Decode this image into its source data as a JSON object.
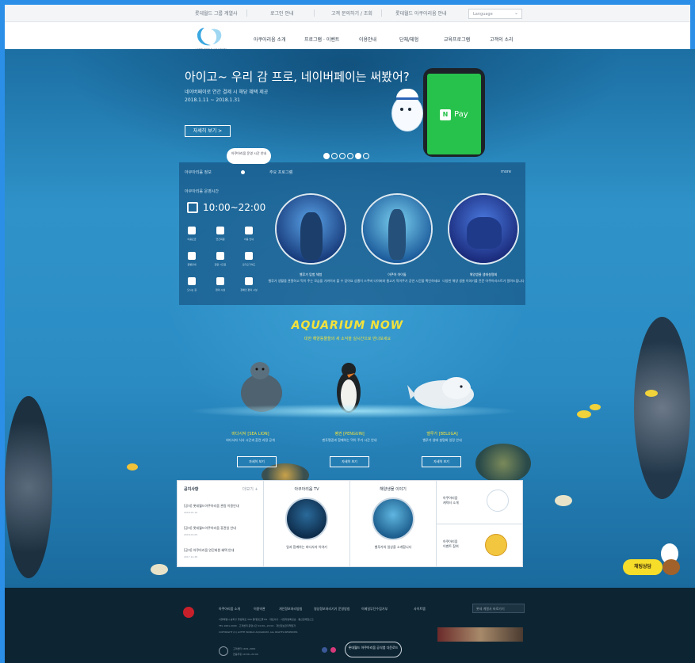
{
  "util_bar": {
    "items": [
      "롯데월드 그룹 계열사",
      "로그인 안내",
      "고객 문의하기 / 조회",
      "롯데월드 아쿠아리움 안내"
    ],
    "language": "Language"
  },
  "header": {
    "logo_text": "LOTTE WORLD AQUARIUM",
    "nav": [
      "아쿠아리움 소개",
      "프로그램 · 이벤트",
      "이용안내",
      "단체/체험",
      "교육프로그램",
      "고객의 소리"
    ]
  },
  "banner": {
    "title": "아이고~ 우리 감 프로, 네이버페이는 써봤어?",
    "sub1": "네이버페이로 연간 결제 시 해당 혜택 제공",
    "sub2": "2018.1.11 ~ 2018.1.31",
    "button": "자세히 보기 >",
    "pay_label": "N",
    "pay_word": "Pay",
    "slide_count": 6,
    "active_slide": 4
  },
  "info": {
    "left_title": "아쿠아리움 정보",
    "bubble": "아쿠아리움 운영 시간 안내",
    "time_label": "아쿠아리움 운영시간",
    "hours": "10:00~22:00",
    "facilities": [
      "이용요금",
      "연간회원",
      "이용 안내",
      "층별안내",
      "관람 시간표",
      "오디오가이드",
      "오시는 길",
      "편의 시설",
      "장애인 편의 시설"
    ],
    "programs_title": "주요 프로그램",
    "more": "more",
    "programs": [
      {
        "name": "벨루가 탐험 체험",
        "desc": "벨루가 생활을 관찰하고 먹이 주는 모습을 가까이서 볼 수 있어요"
      },
      {
        "name": "아쿠아 아이돌",
        "desc": "상괭이 스쿠버 다이버와 물고기 먹이주기 공연 시간을 확인하세요"
      },
      {
        "name": "해양생물 생태설명회",
        "desc": "다양한 해양 생물 이야기를 전문 아쿠아리스트가 알려드립니다"
      }
    ]
  },
  "now": {
    "title": "AQUARIUM NOW",
    "subtitle": "대한 해양동물들의 새 소식을 실시간으로 만나보세요",
    "animals": [
      {
        "name": "바다사자 [SEA LION]",
        "desc": "바다사자 식사 시간과 훈련 과정 공개",
        "button": "자세히 보기"
      },
      {
        "name": "펭귄 [PENGUIN]",
        "desc": "젠투펭귄과 함께하는 먹이 주기 시간 안내",
        "button": "자세히 보기"
      },
      {
        "name": "벨루가 [BELUGA]",
        "desc": "벨루가 생태 설명회 일정 안내",
        "button": "자세히 보기"
      }
    ]
  },
  "cards": {
    "notice_title": "공지사항",
    "notice_more": "더보기 +",
    "notices": [
      {
        "title": "[공지] 롯데월드아쿠아리움 관람 이용안내",
        "date": "2018.01.10"
      },
      {
        "title": "[공지] 롯데월드아쿠아리움 휴관일 안내",
        "date": "2018.01.05"
      },
      {
        "title": "[공지] 아쿠아리움 연간회원 혜택 안내",
        "date": "2017.12.28"
      }
    ],
    "card2_title": "아쿠아리움 TV",
    "card2_cap": "일과 함께하는 바다사자 이야기",
    "card3_title": "해양생물 이야기",
    "card3_cap": "벨루가의 일상을 소개합니다",
    "side1": "아쿠아리움\n캐릭터 소개",
    "side2": "아쿠아리움\n이벤트 참여"
  },
  "chat": "채팅상담",
  "footer": {
    "links": [
      "아쿠아리움 소개",
      "이용약관",
      "개인정보처리방침",
      "영상정보처리기기 운영방침",
      "이메일무단수집거부",
      "사이트맵"
    ],
    "addr1": "서울특별시 송파구 올림픽로 300 롯데월드몰 B1 · 대표이사 · 사업자등록번호 · 통신판매업신고",
    "addr2": "TEL 1661-2000 · 고객센터 운영시간 10:00~22:00 · 개인정보관리책임자",
    "copy": "COPYRIGHT (C) LOTTE WORLD AQUARIUM. ALL RIGHTS RESERVED.",
    "family": "롯데 계열사 바로가기",
    "call1": "고객센터 1661-2000",
    "call2": "연중무휴 10:00~22:00",
    "pill": "롯데월드 아쿠아리움 공식앱 다운로드"
  }
}
